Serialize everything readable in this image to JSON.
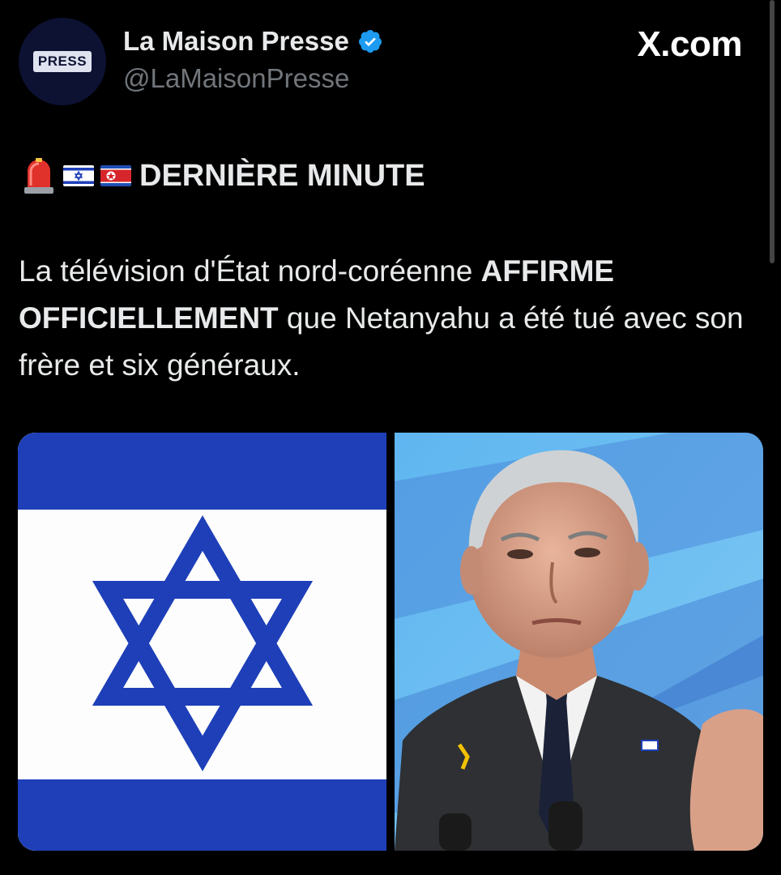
{
  "account": {
    "display_name": "La Maison Presse",
    "handle": "@LaMaisonPresse",
    "avatar_text": "PRESS",
    "verified": true
  },
  "site_label": "X.com",
  "post": {
    "breaking_label": "DERNIÈRE MINUTE",
    "emojis": [
      "rotating-light",
      "flag-israel",
      "flag-north-korea"
    ],
    "text_part1": "La télévision d'État nord-coréenne ",
    "text_bold1": "AFFIRME OFFICIELLEMENT",
    "text_part2": " que Netanyahu a été tué avec son frère et six généraux."
  },
  "media": [
    {
      "kind": "flag-of-israel"
    },
    {
      "kind": "photo-of-man-in-suit"
    }
  ],
  "colors": {
    "background": "#000000",
    "text": "#e7e9ea",
    "secondary_text": "#71767b",
    "verified_blue": "#1d9bf0",
    "israel_blue": "#1e3fb8"
  }
}
